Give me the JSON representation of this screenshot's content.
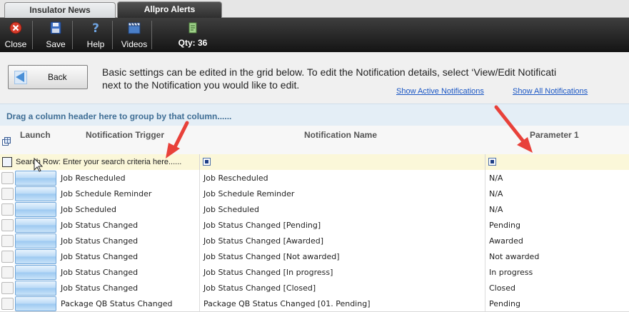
{
  "tabs": [
    {
      "label": "Insulator News",
      "active": false
    },
    {
      "label": "Allpro Alerts",
      "active": true
    }
  ],
  "toolbar": {
    "close_label": "Close",
    "save_label": "Save",
    "help_label": "Help",
    "videos_label": "Videos",
    "qty_label": "Qty: 36"
  },
  "header": {
    "back_label": "Back",
    "info_line1": "Basic settings can be edited in the grid below. To edit the Notification details, select ‘View/Edit Notificati",
    "info_line2": "next to the Notification you would like to edit.",
    "link_active": "Show Active Notifications",
    "link_all": "Show All Notifications"
  },
  "grid": {
    "group_panel_text": "Drag a column header here to group by that column......",
    "columns": {
      "launch": "Launch",
      "trigger": "Notification Trigger",
      "name": "Notification Name",
      "param1": "Parameter 1"
    },
    "search_row_text": "Search Row: Enter your search criteria here......",
    "rows": [
      {
        "trigger": "Job Rescheduled",
        "name": "Job Rescheduled",
        "param1": "N/A"
      },
      {
        "trigger": "Job Schedule Reminder",
        "name": "Job Schedule Reminder",
        "param1": "N/A"
      },
      {
        "trigger": "Job Scheduled",
        "name": "Job Scheduled",
        "param1": "N/A"
      },
      {
        "trigger": "Job Status Changed",
        "name": "Job Status Changed [Pending]",
        "param1": "Pending"
      },
      {
        "trigger": "Job Status Changed",
        "name": "Job Status Changed [Awarded]",
        "param1": "Awarded"
      },
      {
        "trigger": "Job Status Changed",
        "name": "Job Status Changed [Not awarded]",
        "param1": "Not awarded"
      },
      {
        "trigger": "Job Status Changed",
        "name": "Job Status Changed [In progress]",
        "param1": "In progress"
      },
      {
        "trigger": "Job Status Changed",
        "name": "Job Status Changed [Closed]",
        "param1": "Closed"
      },
      {
        "trigger": "Package QB Status Changed",
        "name": "Package QB Status Changed [01. Pending]",
        "param1": "Pending"
      }
    ]
  },
  "colors": {
    "accent_link": "#1a56c4",
    "group_text": "#3f6e95",
    "annotation_arrow": "#e8413a"
  }
}
